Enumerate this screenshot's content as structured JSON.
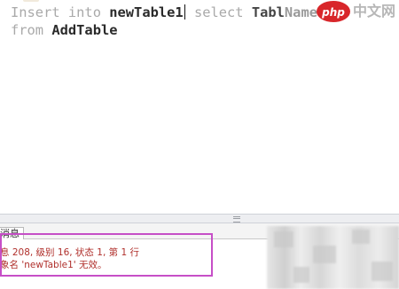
{
  "editor": {
    "line1": {
      "kw_insert": "Insert",
      "kw_into": "into",
      "table_name": "newTable1",
      "kw_select": "select",
      "column_fragment": "Tabl",
      "column_fragment_tail": "Name"
    },
    "line2": {
      "kw_from": "from",
      "source_table": "AddTable"
    }
  },
  "watermark": {
    "logo_text": "php",
    "site_text": "中文网"
  },
  "messages": {
    "tab_label": "消息",
    "line1": "息 208, 级别 16, 状态 1, 第 1 行",
    "line2": "象名 'newTable1' 无效。"
  },
  "colors": {
    "highlight_border": "#c64fc7",
    "error_text": "#b0302c",
    "keyword_gray": "#a9a9a9"
  }
}
